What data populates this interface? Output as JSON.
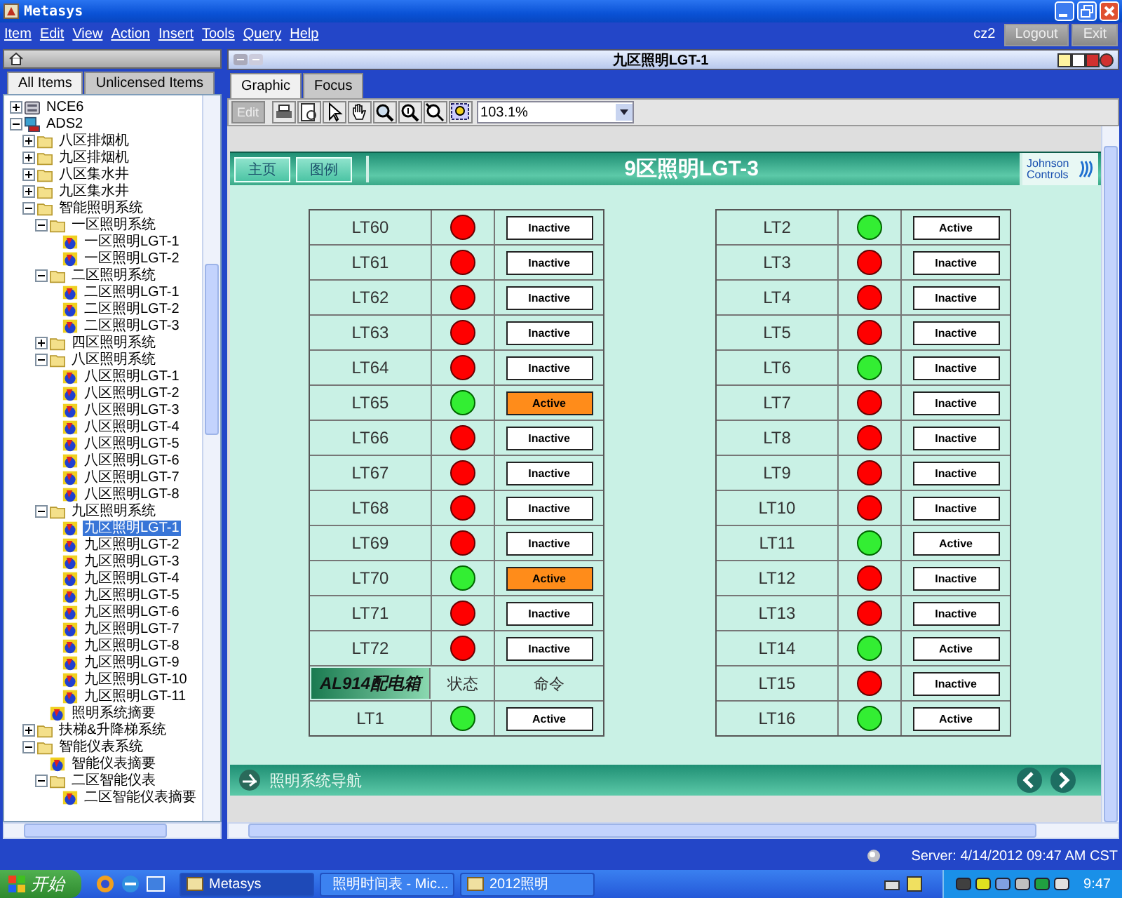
{
  "window": {
    "title": "Metasys"
  },
  "menu": [
    "Item",
    "Edit",
    "View",
    "Action",
    "Insert",
    "Tools",
    "Query",
    "Help"
  ],
  "user": "cz2",
  "buttons": [
    "Logout",
    "Exit"
  ],
  "navigator": {
    "tabs": [
      {
        "label": "All Items",
        "selected": true
      },
      {
        "label": "Unlicensed Items",
        "selected": false
      }
    ],
    "tree": [
      {
        "label": "NCE6",
        "kind": "device",
        "expanded": false,
        "selected": false
      },
      {
        "label": "ADS2",
        "kind": "server",
        "expanded": true,
        "selected": false,
        "children": [
          {
            "label": "八区排烟机",
            "kind": "folder",
            "expanded": false,
            "selected": false
          },
          {
            "label": "九区排烟机",
            "kind": "folder",
            "expanded": false,
            "selected": false
          },
          {
            "label": "八区集水井",
            "kind": "folder",
            "expanded": false,
            "selected": false
          },
          {
            "label": "九区集水井",
            "kind": "folder",
            "expanded": false,
            "selected": false
          },
          {
            "label": "智能照明系统",
            "kind": "folder",
            "expanded": true,
            "selected": false,
            "children": [
              {
                "label": "一区照明系统",
                "kind": "folder",
                "expanded": true,
                "selected": false,
                "children": [
                  {
                    "label": "一区照明LGT-1",
                    "kind": "graphic",
                    "selected": false
                  },
                  {
                    "label": "一区照明LGT-2",
                    "kind": "graphic",
                    "selected": false
                  }
                ]
              },
              {
                "label": "二区照明系统",
                "kind": "folder",
                "expanded": true,
                "selected": false,
                "children": [
                  {
                    "label": "二区照明LGT-1",
                    "kind": "graphic",
                    "selected": false
                  },
                  {
                    "label": "二区照明LGT-2",
                    "kind": "graphic",
                    "selected": false
                  },
                  {
                    "label": "二区照明LGT-3",
                    "kind": "graphic",
                    "selected": false
                  }
                ]
              },
              {
                "label": "四区照明系统",
                "kind": "folder",
                "expanded": false,
                "selected": false
              },
              {
                "label": "八区照明系统",
                "kind": "folder",
                "expanded": true,
                "selected": false,
                "children": [
                  {
                    "label": "八区照明LGT-1",
                    "kind": "graphic",
                    "selected": false
                  },
                  {
                    "label": "八区照明LGT-2",
                    "kind": "graphic",
                    "selected": false
                  },
                  {
                    "label": "八区照明LGT-3",
                    "kind": "graphic",
                    "selected": false
                  },
                  {
                    "label": "八区照明LGT-4",
                    "kind": "graphic",
                    "selected": false
                  },
                  {
                    "label": "八区照明LGT-5",
                    "kind": "graphic",
                    "selected": false
                  },
                  {
                    "label": "八区照明LGT-6",
                    "kind": "graphic",
                    "selected": false
                  },
                  {
                    "label": "八区照明LGT-7",
                    "kind": "graphic",
                    "selected": false
                  },
                  {
                    "label": "八区照明LGT-8",
                    "kind": "graphic",
                    "selected": false
                  }
                ]
              },
              {
                "label": "九区照明系统",
                "kind": "folder",
                "expanded": true,
                "selected": false,
                "children": [
                  {
                    "label": "九区照明LGT-1",
                    "kind": "graphic",
                    "selected": true
                  },
                  {
                    "label": "九区照明LGT-2",
                    "kind": "graphic",
                    "selected": false
                  },
                  {
                    "label": "九区照明LGT-3",
                    "kind": "graphic",
                    "selected": false
                  },
                  {
                    "label": "九区照明LGT-4",
                    "kind": "graphic",
                    "selected": false
                  },
                  {
                    "label": "九区照明LGT-5",
                    "kind": "graphic",
                    "selected": false
                  },
                  {
                    "label": "九区照明LGT-6",
                    "kind": "graphic",
                    "selected": false
                  },
                  {
                    "label": "九区照明LGT-7",
                    "kind": "graphic",
                    "selected": false
                  },
                  {
                    "label": "九区照明LGT-8",
                    "kind": "graphic",
                    "selected": false
                  },
                  {
                    "label": "九区照明LGT-9",
                    "kind": "graphic",
                    "selected": false
                  },
                  {
                    "label": "九区照明LGT-10",
                    "kind": "graphic",
                    "selected": false
                  },
                  {
                    "label": "九区照明LGT-11",
                    "kind": "graphic",
                    "selected": false
                  }
                ]
              },
              {
                "label": "照明系统摘要",
                "kind": "graphic",
                "selected": false
              }
            ]
          },
          {
            "label": "扶梯&升降梯系统",
            "kind": "folder",
            "expanded": false,
            "selected": false
          },
          {
            "label": "智能仪表系统",
            "kind": "folder",
            "expanded": true,
            "selected": false,
            "children": [
              {
                "label": "智能仪表摘要",
                "kind": "graphic",
                "selected": false
              },
              {
                "label": "二区智能仪表",
                "kind": "folder",
                "expanded": true,
                "selected": false,
                "children": [
                  {
                    "label": "二区智能仪表摘要",
                    "kind": "graphic",
                    "selected": false
                  }
                ]
              }
            ]
          }
        ]
      }
    ]
  },
  "panel": {
    "title": "九区照明LGT-1",
    "tabs": [
      {
        "label": "Graphic",
        "selected": true
      },
      {
        "label": "Focus",
        "selected": false
      }
    ],
    "toolbar": {
      "edit": {
        "label": "Edit",
        "disabled": true
      },
      "zoom": "103.1%"
    }
  },
  "graphic": {
    "buttons": [
      "主页",
      "图例"
    ],
    "title": "9区照明LGT-3",
    "logo": "Johnson Controls",
    "left_table": [
      {
        "kind": "point",
        "name": "LT60",
        "on": false,
        "command": "Inactive",
        "highlighted": false
      },
      {
        "kind": "point",
        "name": "LT61",
        "on": false,
        "command": "Inactive",
        "highlighted": false
      },
      {
        "kind": "point",
        "name": "LT62",
        "on": false,
        "command": "Inactive",
        "highlighted": false
      },
      {
        "kind": "point",
        "name": "LT63",
        "on": false,
        "command": "Inactive",
        "highlighted": false
      },
      {
        "kind": "point",
        "name": "LT64",
        "on": false,
        "command": "Inactive",
        "highlighted": false
      },
      {
        "kind": "point",
        "name": "LT65",
        "on": true,
        "command": "Active",
        "highlighted": true
      },
      {
        "kind": "point",
        "name": "LT66",
        "on": false,
        "command": "Inactive",
        "highlighted": false
      },
      {
        "kind": "point",
        "name": "LT67",
        "on": false,
        "command": "Inactive",
        "highlighted": false
      },
      {
        "kind": "point",
        "name": "LT68",
        "on": false,
        "command": "Inactive",
        "highlighted": false
      },
      {
        "kind": "point",
        "name": "LT69",
        "on": false,
        "command": "Inactive",
        "highlighted": false
      },
      {
        "kind": "point",
        "name": "LT70",
        "on": true,
        "command": "Active",
        "highlighted": true
      },
      {
        "kind": "point",
        "name": "LT71",
        "on": false,
        "command": "Inactive",
        "highlighted": false
      },
      {
        "kind": "point",
        "name": "LT72",
        "on": false,
        "command": "Inactive",
        "highlighted": false
      },
      {
        "kind": "header",
        "name": "AL914配电箱",
        "status": "状态",
        "command": "命令"
      },
      {
        "kind": "point",
        "name": "LT1",
        "on": true,
        "command": "Active",
        "highlighted": false
      }
    ],
    "right_table": [
      {
        "kind": "point",
        "name": "LT2",
        "on": true,
        "command": "Active",
        "highlighted": false
      },
      {
        "kind": "point",
        "name": "LT3",
        "on": false,
        "command": "Inactive",
        "highlighted": false
      },
      {
        "kind": "point",
        "name": "LT4",
        "on": false,
        "command": "Inactive",
        "highlighted": false
      },
      {
        "kind": "point",
        "name": "LT5",
        "on": false,
        "command": "Inactive",
        "highlighted": false
      },
      {
        "kind": "point",
        "name": "LT6",
        "on": true,
        "command": "Inactive",
        "highlighted": false
      },
      {
        "kind": "point",
        "name": "LT7",
        "on": false,
        "command": "Inactive",
        "highlighted": false
      },
      {
        "kind": "point",
        "name": "LT8",
        "on": false,
        "command": "Inactive",
        "highlighted": false
      },
      {
        "kind": "point",
        "name": "LT9",
        "on": false,
        "command": "Inactive",
        "highlighted": false
      },
      {
        "kind": "point",
        "name": "LT10",
        "on": false,
        "command": "Inactive",
        "highlighted": false
      },
      {
        "kind": "point",
        "name": "LT11",
        "on": true,
        "command": "Active",
        "highlighted": false
      },
      {
        "kind": "point",
        "name": "LT12",
        "on": false,
        "command": "Inactive",
        "highlighted": false
      },
      {
        "kind": "point",
        "name": "LT13",
        "on": false,
        "command": "Inactive",
        "highlighted": false
      },
      {
        "kind": "point",
        "name": "LT14",
        "on": true,
        "command": "Active",
        "highlighted": false
      },
      {
        "kind": "point",
        "name": "LT15",
        "on": false,
        "command": "Inactive",
        "highlighted": false
      },
      {
        "kind": "point",
        "name": "LT16",
        "on": true,
        "command": "Active",
        "highlighted": false
      }
    ],
    "footer": "照明系统导航"
  },
  "status_bar": "Server: 4/14/2012 09:47 AM CST",
  "taskbar": {
    "start": "开始",
    "windows": [
      {
        "label": "Metasys",
        "selected": true
      },
      {
        "label": "照明时间表 - Mic...",
        "selected": false
      },
      {
        "label": "2012照明",
        "selected": false
      }
    ],
    "clock": "9:47"
  }
}
